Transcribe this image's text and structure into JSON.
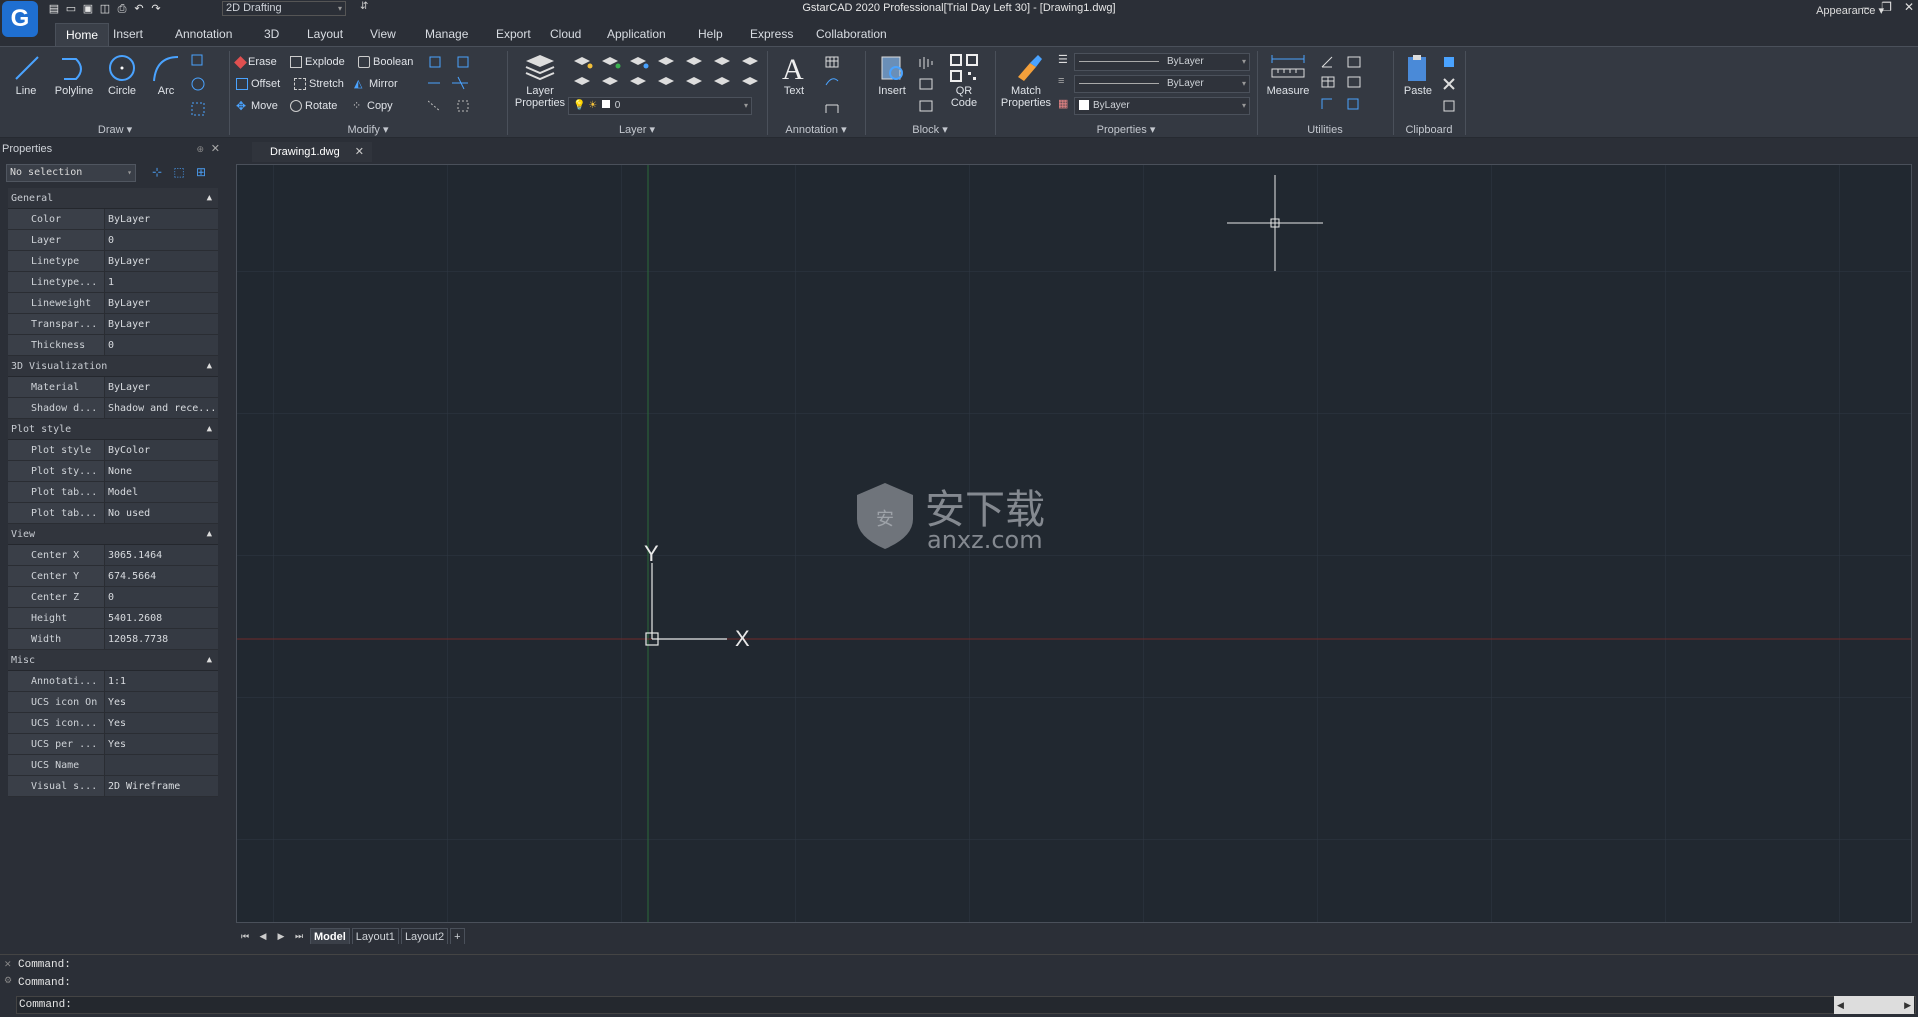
{
  "app": {
    "title": "GstarCAD 2020 Professional[Trial Day Left 30] - [Drawing1.dwg]",
    "logo_letter": "G",
    "workspace": "2D Drafting",
    "appearance": "Appearance"
  },
  "ribbon_tabs": [
    "Home",
    "Insert",
    "Annotation",
    "3D",
    "Layout",
    "View",
    "Manage",
    "Export",
    "Cloud",
    "Application",
    "Help",
    "Express",
    "Collaboration"
  ],
  "active_tab": "Home",
  "draw": {
    "title": "Draw",
    "line": "Line",
    "polyline": "Polyline",
    "circle": "Circle",
    "arc": "Arc"
  },
  "modify": {
    "title": "Modify",
    "erase": "Erase",
    "explode": "Explode",
    "boolean": "Boolean",
    "offset": "Offset",
    "stretch": "Stretch",
    "mirror": "Mirror",
    "move": "Move",
    "rotate": "Rotate",
    "copy": "Copy"
  },
  "layer": {
    "title": "Layer",
    "layer_properties_1": "Layer",
    "layer_properties_2": "Properties",
    "current": "0"
  },
  "annotation": {
    "title": "Annotation",
    "text": "Text"
  },
  "block": {
    "title": "Block",
    "insert": "Insert",
    "qr_1": "QR",
    "qr_2": "Code"
  },
  "properties_panel": {
    "title": "Properties",
    "match_1": "Match",
    "match_2": "Properties",
    "color": "ByLayer",
    "linetype": "ByLayer",
    "lineweight": "ByLayer"
  },
  "utilities": {
    "title": "Utilities",
    "measure": "Measure"
  },
  "clipboard": {
    "title": "Clipboard",
    "paste": "Paste"
  },
  "props": {
    "header": "Properties",
    "selection": "No selection",
    "sections": [
      {
        "name": "General",
        "rows": [
          [
            "Color",
            "ByLayer"
          ],
          [
            "Layer",
            "0"
          ],
          [
            "Linetype",
            "ByLayer"
          ],
          [
            "Linetype...",
            "1"
          ],
          [
            "Lineweight",
            "ByLayer"
          ],
          [
            "Transpar...",
            "ByLayer"
          ],
          [
            "Thickness",
            "0"
          ]
        ]
      },
      {
        "name": "3D Visualization",
        "rows": [
          [
            "Material",
            "ByLayer"
          ],
          [
            "Shadow d...",
            "Shadow and rece..."
          ]
        ]
      },
      {
        "name": "Plot style",
        "rows": [
          [
            "Plot style",
            "ByColor"
          ],
          [
            "Plot sty...",
            "None"
          ],
          [
            "Plot tab...",
            "Model"
          ],
          [
            "Plot tab...",
            "No used"
          ]
        ]
      },
      {
        "name": "View",
        "rows": [
          [
            "Center X",
            "3065.1464"
          ],
          [
            "Center Y",
            "674.5664"
          ],
          [
            "Center Z",
            "0"
          ],
          [
            "Height",
            "5401.2608"
          ],
          [
            "Width",
            "12058.7738"
          ]
        ]
      },
      {
        "name": "Misc",
        "rows": [
          [
            "Annotati...",
            "1:1"
          ],
          [
            "UCS icon On",
            "Yes"
          ],
          [
            "UCS icon...",
            "Yes"
          ],
          [
            "UCS per ...",
            "Yes"
          ],
          [
            "UCS Name",
            ""
          ],
          [
            "Visual s...",
            "2D Wireframe"
          ]
        ]
      }
    ]
  },
  "document": {
    "tab": "Drawing1.dwg",
    "watermark_cn": "安下载",
    "watermark_url": "anxz.com",
    "ucs_x": "X",
    "ucs_y": "Y"
  },
  "layout_tabs": [
    "Model",
    "Layout1",
    "Layout2",
    "+"
  ],
  "command": {
    "lines": [
      "Command:",
      "Command:"
    ],
    "prompt": "Command:"
  },
  "colors": {
    "canvas": "#212830",
    "grid": "#2e3640",
    "x_axis": "#8a2a2a",
    "y_axis": "#2a7a3a",
    "accent": "#1f6fd1"
  }
}
